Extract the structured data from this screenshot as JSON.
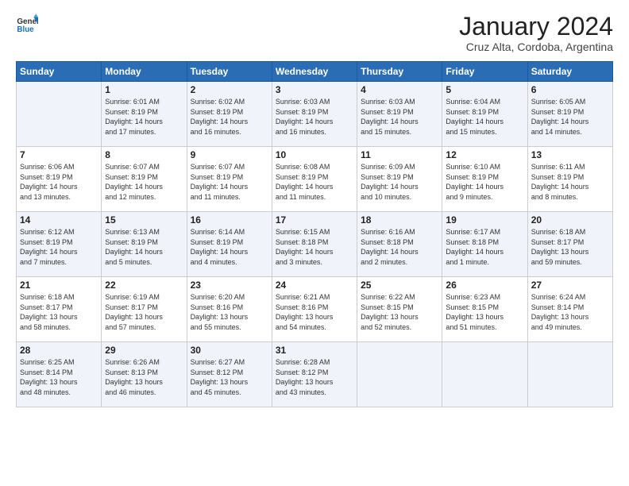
{
  "logo": {
    "general": "General",
    "blue": "Blue"
  },
  "header": {
    "month": "January 2024",
    "location": "Cruz Alta, Cordoba, Argentina"
  },
  "weekdays": [
    "Sunday",
    "Monday",
    "Tuesday",
    "Wednesday",
    "Thursday",
    "Friday",
    "Saturday"
  ],
  "weeks": [
    [
      {
        "day": "",
        "info": ""
      },
      {
        "day": "1",
        "info": "Sunrise: 6:01 AM\nSunset: 8:19 PM\nDaylight: 14 hours\nand 17 minutes."
      },
      {
        "day": "2",
        "info": "Sunrise: 6:02 AM\nSunset: 8:19 PM\nDaylight: 14 hours\nand 16 minutes."
      },
      {
        "day": "3",
        "info": "Sunrise: 6:03 AM\nSunset: 8:19 PM\nDaylight: 14 hours\nand 16 minutes."
      },
      {
        "day": "4",
        "info": "Sunrise: 6:03 AM\nSunset: 8:19 PM\nDaylight: 14 hours\nand 15 minutes."
      },
      {
        "day": "5",
        "info": "Sunrise: 6:04 AM\nSunset: 8:19 PM\nDaylight: 14 hours\nand 15 minutes."
      },
      {
        "day": "6",
        "info": "Sunrise: 6:05 AM\nSunset: 8:19 PM\nDaylight: 14 hours\nand 14 minutes."
      }
    ],
    [
      {
        "day": "7",
        "info": "Sunrise: 6:06 AM\nSunset: 8:19 PM\nDaylight: 14 hours\nand 13 minutes."
      },
      {
        "day": "8",
        "info": "Sunrise: 6:07 AM\nSunset: 8:19 PM\nDaylight: 14 hours\nand 12 minutes."
      },
      {
        "day": "9",
        "info": "Sunrise: 6:07 AM\nSunset: 8:19 PM\nDaylight: 14 hours\nand 11 minutes."
      },
      {
        "day": "10",
        "info": "Sunrise: 6:08 AM\nSunset: 8:19 PM\nDaylight: 14 hours\nand 11 minutes."
      },
      {
        "day": "11",
        "info": "Sunrise: 6:09 AM\nSunset: 8:19 PM\nDaylight: 14 hours\nand 10 minutes."
      },
      {
        "day": "12",
        "info": "Sunrise: 6:10 AM\nSunset: 8:19 PM\nDaylight: 14 hours\nand 9 minutes."
      },
      {
        "day": "13",
        "info": "Sunrise: 6:11 AM\nSunset: 8:19 PM\nDaylight: 14 hours\nand 8 minutes."
      }
    ],
    [
      {
        "day": "14",
        "info": "Sunrise: 6:12 AM\nSunset: 8:19 PM\nDaylight: 14 hours\nand 7 minutes."
      },
      {
        "day": "15",
        "info": "Sunrise: 6:13 AM\nSunset: 8:19 PM\nDaylight: 14 hours\nand 5 minutes."
      },
      {
        "day": "16",
        "info": "Sunrise: 6:14 AM\nSunset: 8:19 PM\nDaylight: 14 hours\nand 4 minutes."
      },
      {
        "day": "17",
        "info": "Sunrise: 6:15 AM\nSunset: 8:18 PM\nDaylight: 14 hours\nand 3 minutes."
      },
      {
        "day": "18",
        "info": "Sunrise: 6:16 AM\nSunset: 8:18 PM\nDaylight: 14 hours\nand 2 minutes."
      },
      {
        "day": "19",
        "info": "Sunrise: 6:17 AM\nSunset: 8:18 PM\nDaylight: 14 hours\nand 1 minute."
      },
      {
        "day": "20",
        "info": "Sunrise: 6:18 AM\nSunset: 8:17 PM\nDaylight: 13 hours\nand 59 minutes."
      }
    ],
    [
      {
        "day": "21",
        "info": "Sunrise: 6:18 AM\nSunset: 8:17 PM\nDaylight: 13 hours\nand 58 minutes."
      },
      {
        "day": "22",
        "info": "Sunrise: 6:19 AM\nSunset: 8:17 PM\nDaylight: 13 hours\nand 57 minutes."
      },
      {
        "day": "23",
        "info": "Sunrise: 6:20 AM\nSunset: 8:16 PM\nDaylight: 13 hours\nand 55 minutes."
      },
      {
        "day": "24",
        "info": "Sunrise: 6:21 AM\nSunset: 8:16 PM\nDaylight: 13 hours\nand 54 minutes."
      },
      {
        "day": "25",
        "info": "Sunrise: 6:22 AM\nSunset: 8:15 PM\nDaylight: 13 hours\nand 52 minutes."
      },
      {
        "day": "26",
        "info": "Sunrise: 6:23 AM\nSunset: 8:15 PM\nDaylight: 13 hours\nand 51 minutes."
      },
      {
        "day": "27",
        "info": "Sunrise: 6:24 AM\nSunset: 8:14 PM\nDaylight: 13 hours\nand 49 minutes."
      }
    ],
    [
      {
        "day": "28",
        "info": "Sunrise: 6:25 AM\nSunset: 8:14 PM\nDaylight: 13 hours\nand 48 minutes."
      },
      {
        "day": "29",
        "info": "Sunrise: 6:26 AM\nSunset: 8:13 PM\nDaylight: 13 hours\nand 46 minutes."
      },
      {
        "day": "30",
        "info": "Sunrise: 6:27 AM\nSunset: 8:12 PM\nDaylight: 13 hours\nand 45 minutes."
      },
      {
        "day": "31",
        "info": "Sunrise: 6:28 AM\nSunset: 8:12 PM\nDaylight: 13 hours\nand 43 minutes."
      },
      {
        "day": "",
        "info": ""
      },
      {
        "day": "",
        "info": ""
      },
      {
        "day": "",
        "info": ""
      }
    ]
  ]
}
